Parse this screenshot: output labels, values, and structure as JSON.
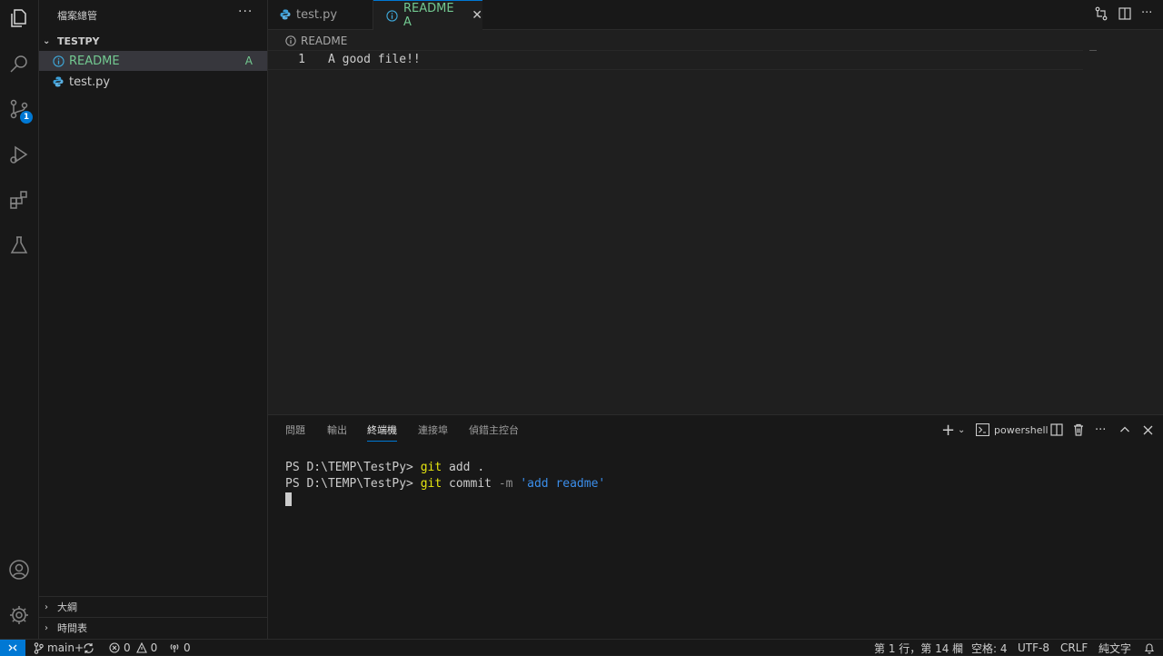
{
  "sidebar": {
    "title": "檔案總管",
    "more": "···",
    "folder": "TESTPY",
    "files": [
      {
        "name": "README",
        "status": "A",
        "color": "#73c991"
      },
      {
        "name": "test.py",
        "status": "",
        "color": "#cccccc"
      }
    ],
    "sections": [
      "大綱",
      "時間表"
    ]
  },
  "activity": {
    "scm_badge": "1"
  },
  "tabs": [
    {
      "label": "test.py",
      "state": "inactive"
    },
    {
      "label": "README A",
      "state": "active"
    }
  ],
  "editor": {
    "breadcrumb": "README",
    "lines": [
      {
        "num": "1",
        "text": "A good file!!"
      }
    ]
  },
  "panel": {
    "tabs": [
      "問題",
      "輸出",
      "終端機",
      "連接埠",
      "偵錯主控台"
    ],
    "active_tab": "終端機",
    "shell_label": "powershell",
    "terminal": [
      {
        "prompt": "PS D:\\TEMP\\TestPy> ",
        "cmd": "git",
        "rest": " add ."
      },
      {
        "prompt": "PS D:\\TEMP\\TestPy> ",
        "cmd": "git",
        "rest": " commit ",
        "flag": "-m",
        "str": "'add readme'"
      }
    ]
  },
  "status": {
    "branch": "main+",
    "errors": "0",
    "warnings": "0",
    "ports": "0",
    "cursor_pos": "第 1 行，第 14 欄",
    "spaces": "空格: 4",
    "encoding": "UTF-8",
    "eol": "CRLF",
    "language": "純文字"
  },
  "colors": {
    "accent": "#0078d4",
    "added": "#73c991",
    "bg": "#1f1f1f",
    "side": "#181818"
  }
}
